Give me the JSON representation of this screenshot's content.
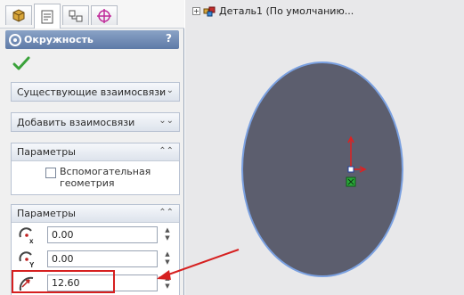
{
  "tree": {
    "expand_label": "+",
    "part_label": "Деталь1  (По умолчанию..."
  },
  "panel": {
    "title": "Окружность",
    "help": "?",
    "groups": {
      "existing_relations": "Существующие взаимосвязи",
      "add_relations": "Добавить взаимосвязи",
      "options": "Параметры",
      "parameters": "Параметры"
    },
    "aux_geometry_label": "Вспомогательная геометрия",
    "params": {
      "center_x": "0.00",
      "center_y": "0.00",
      "radius": "12.60"
    }
  },
  "colors": {
    "title_bar": "#6a86b2",
    "circle_fill": "#5c5e6e",
    "circle_edge": "#7aa0e0",
    "annotation": "#d62020"
  }
}
